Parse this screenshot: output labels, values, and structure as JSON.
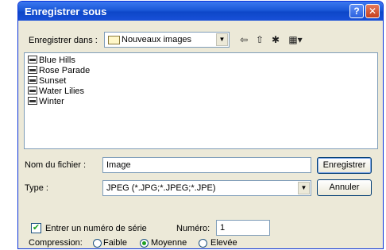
{
  "window": {
    "title": "Enregistrer sous",
    "help_glyph": "?",
    "close_glyph": "✕"
  },
  "save_in": {
    "label": "Enregistrer dans :",
    "value": "Nouveaux images",
    "folder_icon": "folder-icon"
  },
  "nav_icons": {
    "back": "⇦",
    "up": "⇧",
    "new_folder": "✱",
    "view_menu": "▦▾"
  },
  "files": [
    {
      "name": "Blue Hills"
    },
    {
      "name": "Rose Parade"
    },
    {
      "name": "Sunset"
    },
    {
      "name": "Water Lilies"
    },
    {
      "name": "Winter"
    }
  ],
  "filename": {
    "label": "Nom du fichier :",
    "value": "Image"
  },
  "filetype": {
    "label": "Type :",
    "value": "JPEG (*.JPG;*.JPEG;*.JPE)"
  },
  "buttons": {
    "save": "Enregistrer",
    "cancel": "Annuler"
  },
  "serial": {
    "checkbox_label": "Entrer un numéro de série",
    "checked": true,
    "number_label": "Numéro:",
    "number_value": "1"
  },
  "compression": {
    "label": "Compression:",
    "options": [
      "Faible",
      "Moyenne",
      "Elevée"
    ],
    "selected": "Moyenne"
  },
  "colors": {
    "titlebar": "#0d47c8",
    "dialog_bg": "#ece9d8",
    "border": "#7f9db9"
  }
}
